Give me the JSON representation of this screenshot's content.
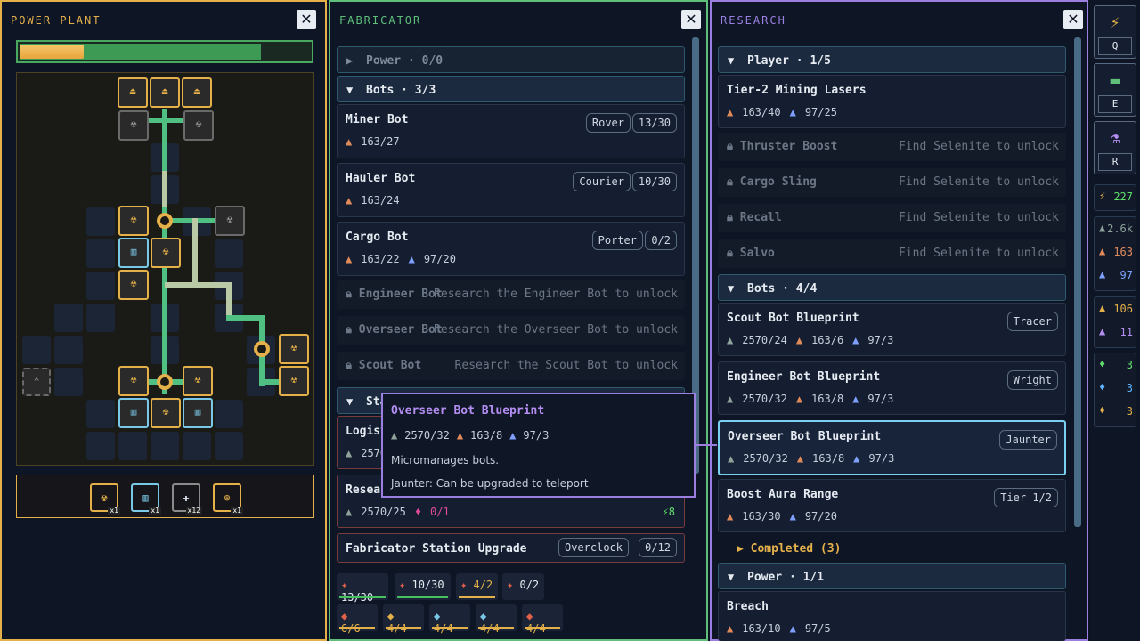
{
  "power_plant": {
    "title": "POWER PLANT",
    "close": "✕",
    "bar_fill": 0.83,
    "sub_fill": 0.22,
    "tray": [
      {
        "icon": "radiation-icon",
        "glyph": "☢",
        "qty": "x1"
      },
      {
        "icon": "bars-icon",
        "glyph": "▥",
        "qty": "x1"
      },
      {
        "icon": "cross-pipe-icon",
        "glyph": "✚",
        "qty": "x12"
      },
      {
        "icon": "node-icon",
        "glyph": "⊕",
        "qty": "x1"
      }
    ]
  },
  "fabricator": {
    "title": "FABRICATOR",
    "close": "✕",
    "power_header": "Power · 0/0",
    "bots_header": "Bots · 3/3",
    "bots": [
      {
        "name": "Miner Bot",
        "chip": "Rover",
        "count": "13/30",
        "res": [
          {
            "icon": "ore-icon",
            "g": "▲",
            "v": "163/27"
          }
        ]
      },
      {
        "name": "Hauler Bot",
        "chip": "Courier",
        "count": "10/30",
        "res": [
          {
            "icon": "ore-icon",
            "g": "▲",
            "v": "163/24"
          }
        ]
      },
      {
        "name": "Cargo Bot",
        "chip": "Porter",
        "count": "0/2",
        "res": [
          {
            "icon": "ore-icon",
            "g": "▲",
            "v": "163/22"
          },
          {
            "icon": "crystal-icon",
            "g": "▲",
            "v": "97/20"
          }
        ]
      }
    ],
    "locked": [
      {
        "name": "Engineer Bot",
        "hint": "Research the Engineer Bot to unlock"
      },
      {
        "name": "Overseer Bot",
        "hint": "Research the Overseer Bot to unlock"
      },
      {
        "name": "Scout Bot",
        "hint": "Research the Scout Bot to unlock"
      }
    ],
    "stations_header": "Sta",
    "logist": {
      "name": "Logist",
      "res": "2570"
    },
    "resea": {
      "name": "Resea",
      "res1": "2570/25",
      "res2": "0/1",
      "power": "8"
    },
    "upgrade": {
      "name": "Fabricator Station Upgrade",
      "chip": "Overclock",
      "count": "0/12"
    },
    "bottom_row1": [
      {
        "icon": "miner-icon",
        "v": "13/30"
      },
      {
        "icon": "hauler-icon",
        "v": "10/30"
      },
      {
        "icon": "drone-icon",
        "v": "4/2"
      },
      {
        "icon": "cargo-icon",
        "v": "0/2"
      }
    ],
    "bottom_row2": [
      {
        "icon": "bot-a-icon",
        "v": "6/6"
      },
      {
        "icon": "bot-b-icon",
        "v": "4/4"
      },
      {
        "icon": "bot-c-icon",
        "v": "4/4"
      },
      {
        "icon": "bot-d-icon",
        "v": "4/4"
      },
      {
        "icon": "bot-e-icon",
        "v": "4/4"
      }
    ]
  },
  "tooltip": {
    "title": "Overseer Bot Blueprint",
    "res": [
      "2570/32",
      "163/8",
      "97/3"
    ],
    "desc": "Micromanages bots.",
    "upgrade": "Jaunter: Can be upgraded to teleport"
  },
  "research": {
    "title": "RESEARCH",
    "close": "✕",
    "player_header": "Player · 1/5",
    "player_first": {
      "name": "Tier-2 Mining Lasers",
      "res": [
        "163/40",
        "97/25"
      ]
    },
    "player_locked": [
      {
        "name": "Thruster Boost",
        "hint": "Find Selenite to unlock"
      },
      {
        "name": "Cargo Sling",
        "hint": "Find Selenite to unlock"
      },
      {
        "name": "Recall",
        "hint": "Find Selenite to unlock"
      },
      {
        "name": "Salvo",
        "hint": "Find Selenite to unlock"
      }
    ],
    "bots_header": "Bots · 4/4",
    "bots": [
      {
        "name": "Scout Bot Blueprint",
        "chip": "Tracer",
        "res": [
          "2570/24",
          "163/6",
          "97/3"
        ]
      },
      {
        "name": "Engineer Bot Blueprint",
        "chip": "Wright",
        "res": [
          "2570/32",
          "163/8",
          "97/3"
        ]
      },
      {
        "name": "Overseer Bot Blueprint",
        "chip": "Jaunter",
        "res": [
          "2570/32",
          "163/8",
          "97/3"
        ]
      },
      {
        "name": "Boost Aura Range",
        "chip": "Tier 1/2",
        "res": [
          "163/30",
          "97/20"
        ]
      }
    ],
    "completed": "Completed (3)",
    "power_header": "Power · 1/1",
    "breach": {
      "name": "Breach",
      "res": [
        "163/10",
        "97/5"
      ]
    }
  },
  "sidebar": {
    "buttons": [
      {
        "icon": "bolt-icon",
        "glyph": "⚡",
        "key": "Q",
        "color": "#e4b04a"
      },
      {
        "icon": "anvil-icon",
        "glyph": "▬",
        "key": "E",
        "color": "#5fbf7a"
      },
      {
        "icon": "flask-icon",
        "glyph": "⚗",
        "key": "R",
        "color": "#b48ef2"
      }
    ],
    "power": "227",
    "group1": [
      {
        "icon": "scrap-icon",
        "v": "2.6k",
        "color": "#8fa39a"
      },
      {
        "icon": "ore-icon",
        "v": "163",
        "color": "#e08a5a"
      },
      {
        "icon": "crystal-icon",
        "v": "97",
        "color": "#7fa0ff"
      }
    ],
    "group2": [
      {
        "icon": "gold-ore-icon",
        "v": "106",
        "color": "#e4b04a"
      },
      {
        "icon": "purple-ore-icon",
        "v": "11",
        "color": "#b48ef2"
      }
    ],
    "group3": [
      {
        "icon": "green-crystal-icon",
        "v": "3",
        "color": "#5fdf6a"
      },
      {
        "icon": "blue-gem-icon",
        "v": "3",
        "color": "#5fb4ff"
      },
      {
        "icon": "yellow-gem-icon",
        "v": "3",
        "color": "#e4b04a"
      }
    ]
  }
}
